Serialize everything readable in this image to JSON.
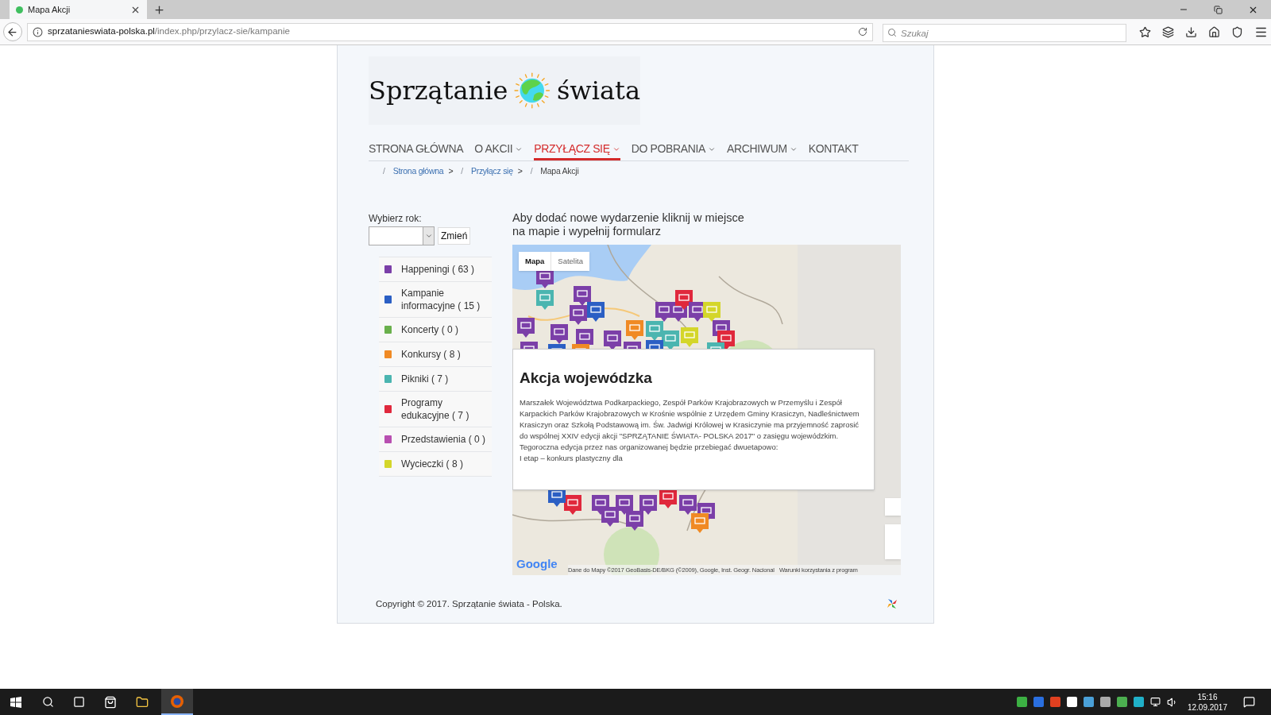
{
  "browser": {
    "tab": {
      "title": "Mapa Akcji"
    },
    "url": {
      "domain": "sprzatanieswiata-polska.pl",
      "path": "/index.php/przylacz-sie/kampanie"
    },
    "search": {
      "placeholder": "Szukaj"
    }
  },
  "logo": {
    "text_left": "Sprzątanie",
    "text_right": "świata"
  },
  "nav": [
    {
      "label": "STRONA GŁÓWNA",
      "dropdown": false,
      "selected": false
    },
    {
      "label": "O AKCII",
      "dropdown": true,
      "selected": false
    },
    {
      "label": "PRZYŁĄCZ SIĘ",
      "dropdown": true,
      "selected": true
    },
    {
      "label": "DO POBRANIA",
      "dropdown": true,
      "selected": false
    },
    {
      "label": "ARCHIWUM",
      "dropdown": true,
      "selected": false
    },
    {
      "label": "KONTAKT",
      "dropdown": false,
      "selected": false
    }
  ],
  "breadcrumb": [
    {
      "divider": "/",
      "label": "Strona główna",
      "link": true,
      "separator": ">"
    },
    {
      "divider": "/",
      "label": "Przyłącz się",
      "link": true,
      "separator": ">"
    },
    {
      "divider": "/",
      "label": "Mapa Akcji",
      "link": false
    }
  ],
  "year_filter": {
    "label": "Wybierz rok:",
    "button": "Zmień"
  },
  "legend": [
    {
      "label": "Happeningi ( 63 )",
      "color": "#7b3fa8"
    },
    {
      "label": "Kampanie informacyjne ( 15 )",
      "color": "#2b5fc4"
    },
    {
      "label": "Koncerty ( 0 )",
      "color": "#6ab04c"
    },
    {
      "label": "Konkursy ( 8 )",
      "color": "#f08a24"
    },
    {
      "label": "Pikniki ( 7 )",
      "color": "#4bb5b0"
    },
    {
      "label": "Programy edukacyjne ( 7 )",
      "color": "#e0283c"
    },
    {
      "label": "Przedstawienia ( 0 )",
      "color": "#b84fb0"
    },
    {
      "label": "Wycieczki ( 8 )",
      "color": "#d4d62a"
    }
  ],
  "map": {
    "heading": "Aby dodać nowe wydarzenie kliknij w miejsce na mapie i wypełnij formularz",
    "type_tabs": [
      {
        "label": "Mapa",
        "selected": true
      },
      {
        "label": "Satelita",
        "selected": false
      }
    ],
    "popup": {
      "title": "Akcja wojewódzka",
      "paragraphs": [
        "Marszałek Województwa Podkarpackiego, Zespół Parków Krajobrazowych w Przemyślu i Zespół Karpackich Parków Krajobrazowych w Krośnie wspólnie z Urzędem Gminy Krasiczyn, Nadleśnictwem Krasiczyn oraz Szkołą Podstawową im. Św. Jadwigi Królowej w Krasiczynie ma przyjemność zaprosić do wspólnej XXIV edycji akcji \"SPRZĄTANIE ŚWIATA- POLSKA 2017\" o zasięgu wojewódzkim.",
        "Tegoroczna edycja przez nas organizowanej będzie przebiegać dwuetapowo:",
        "I etap – konkurs plastyczny dla"
      ]
    },
    "logo": "Google",
    "attribution": "Dane do Mapy ©2017 GeoBasis-DE/BKG (©2009), Google, Inst. Geogr. Nacional",
    "terms": "Warunki korzystania z program"
  },
  "footer": {
    "copyright": "Copyright © 2017. Sprzątanie świata - Polska."
  },
  "taskbar": {
    "time": "15:16",
    "date": "12.09.2017"
  }
}
